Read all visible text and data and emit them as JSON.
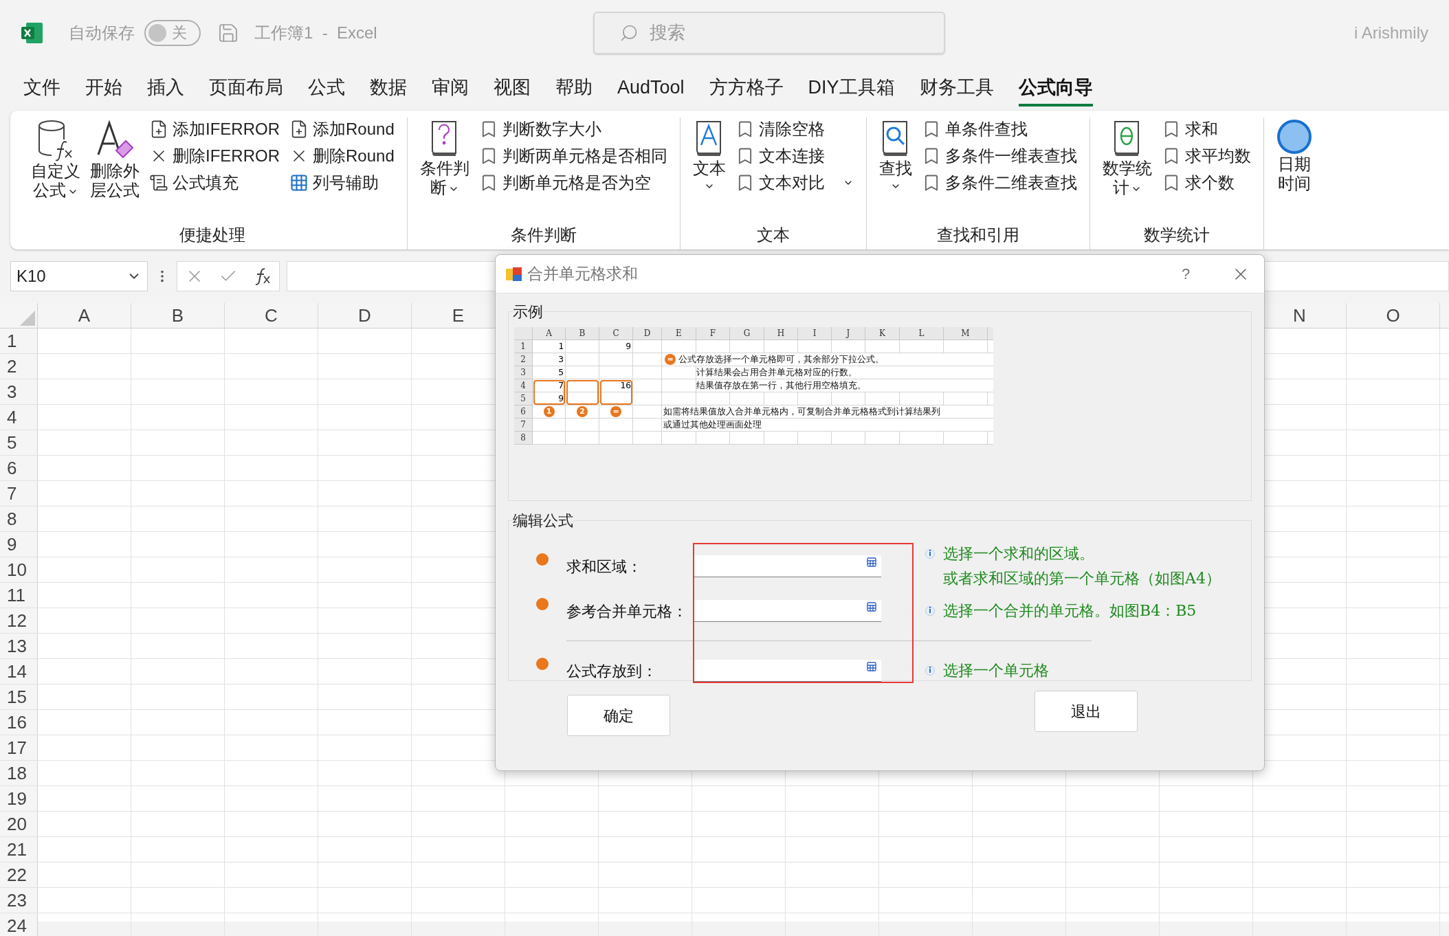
{
  "title_bar": {
    "autosave_label": "自动保存",
    "autosave": {
      "label": "关",
      "on": false
    },
    "document": "工作簿1  -  Excel",
    "search": {
      "placeholder": "搜索"
    },
    "user": "i Arishmily"
  },
  "menu_tabs": [
    {
      "label": "文件",
      "selected": false
    },
    {
      "label": "开始",
      "selected": false
    },
    {
      "label": "插入",
      "selected": false
    },
    {
      "label": "页面布局",
      "selected": false
    },
    {
      "label": "公式",
      "selected": false
    },
    {
      "label": "数据",
      "selected": false
    },
    {
      "label": "审阅",
      "selected": false
    },
    {
      "label": "视图",
      "selected": false
    },
    {
      "label": "帮助",
      "selected": false
    },
    {
      "label": "AudTool",
      "selected": false
    },
    {
      "label": "方方格子",
      "selected": false
    },
    {
      "label": "DIY工具箱",
      "selected": false
    },
    {
      "label": "财务工具",
      "selected": false
    },
    {
      "label": "公式向导",
      "selected": true
    }
  ],
  "ribbon": {
    "groups": [
      {
        "label": "便捷处理",
        "buttons": [
          {
            "kind": "large",
            "lines": [
              "自定义",
              "公式"
            ],
            "dropdown": true
          },
          {
            "kind": "large",
            "lines": [
              "删除外",
              "层公式"
            ],
            "dropdown": false
          },
          {
            "kind": "small",
            "label": "添加IFERROR",
            "dropdown": false
          },
          {
            "kind": "small",
            "label": "删除IFERROR",
            "dropdown": false
          },
          {
            "kind": "small",
            "label": "公式填充",
            "dropdown": false
          },
          {
            "kind": "small",
            "label": "添加Round",
            "dropdown": false
          },
          {
            "kind": "small",
            "label": "删除Round",
            "dropdown": false
          },
          {
            "kind": "small",
            "label": "列号辅助",
            "dropdown": false
          }
        ]
      },
      {
        "label": "条件判断",
        "buttons": [
          {
            "kind": "large",
            "lines": [
              "条件判",
              "断"
            ],
            "dropdown": true
          },
          {
            "kind": "small",
            "label": "判断数字大小",
            "dropdown": false
          },
          {
            "kind": "small",
            "label": "判断两单元格是否相同",
            "dropdown": false
          },
          {
            "kind": "small",
            "label": "判断单元格是否为空",
            "dropdown": false
          }
        ]
      },
      {
        "label": "文本",
        "buttons": [
          {
            "kind": "large",
            "lines": [
              "文本"
            ],
            "dropdown": true
          },
          {
            "kind": "small",
            "label": "清除空格",
            "dropdown": false
          },
          {
            "kind": "small",
            "label": "文本连接",
            "dropdown": false
          },
          {
            "kind": "small",
            "label": "文本对比",
            "dropdown": true
          }
        ]
      },
      {
        "label": "查找和引用",
        "buttons": [
          {
            "kind": "large",
            "lines": [
              "查找"
            ],
            "dropdown": true
          },
          {
            "kind": "small",
            "label": "单条件查找",
            "dropdown": false
          },
          {
            "kind": "small",
            "label": "多条件一维表查找",
            "dropdown": false
          },
          {
            "kind": "small",
            "label": "多条件二维表查找",
            "dropdown": false
          }
        ]
      },
      {
        "label": "数学统计",
        "buttons": [
          {
            "kind": "large",
            "lines": [
              "数学统",
              "计"
            ],
            "dropdown": true
          },
          {
            "kind": "small",
            "label": "求和",
            "dropdown": false
          },
          {
            "kind": "small",
            "label": "求平均数",
            "dropdown": false
          },
          {
            "kind": "small",
            "label": "求个数",
            "dropdown": false
          }
        ]
      },
      {
        "buttons": [
          {
            "kind": "large",
            "lines": [
              "日期",
              "时间"
            ],
            "dropdown": false
          }
        ]
      }
    ]
  },
  "formula_bar": {
    "name_box": "K10"
  },
  "sheet": {
    "columns": [
      "A",
      "B",
      "C",
      "D",
      "E",
      "N",
      "O"
    ],
    "rows": [
      "1",
      "2",
      "3",
      "4",
      "5",
      "6",
      "7",
      "8",
      "9",
      "10",
      "11",
      "12",
      "13",
      "14",
      "15",
      "16",
      "17",
      "18",
      "19",
      "20",
      "21",
      "22",
      "23",
      "24"
    ]
  },
  "dialog": {
    "title": "合并单元格求和",
    "help": "?",
    "example": {
      "legend": "示例",
      "columns": [
        "A",
        "B",
        "C",
        "D",
        "E",
        "F",
        "G",
        "H",
        "I",
        "J",
        "K",
        "L",
        "M"
      ],
      "rows": [
        {
          "label": "1",
          "a": "1",
          "c": "9"
        },
        {
          "label": "2",
          "a": "3",
          "note": "公式存放选择一个单元格即可，其余部分下拉公式。",
          "kind": "badge",
          "note_badge": "="
        },
        {
          "label": "3",
          "a": "5",
          "note": "计算结果会占用合并单元格对应的行数。",
          "kind": "indent"
        },
        {
          "label": "4",
          "a": "7",
          "c": "16",
          "note": "结果值存放在第一行，其他行用空格填充。",
          "kind": "indent"
        },
        {
          "label": "5",
          "a": "9"
        },
        {
          "label": "6",
          "badges": [
            "1",
            "2",
            "="
          ],
          "note": "如需将结果值放入合并单元格内，可复制合并单元格格式到计算结果列",
          "kind": "plain"
        },
        {
          "label": "7",
          "note": "或通过其他处理画面处理",
          "kind": "plain"
        },
        {
          "label": "8"
        }
      ]
    },
    "form": {
      "legend": "编辑公式",
      "fields": [
        {
          "label": "求和区域：",
          "hints": [
            "选择一个求和的区域。",
            "或者求和区域的第一个单元格（如图A4）"
          ]
        },
        {
          "label": "参考合并单元格：",
          "hints": [
            "选择一个合并的单元格。如图B4：B5"
          ]
        },
        {
          "label": "公式存放到：",
          "hints": [
            "选择一个单元格"
          ]
        }
      ]
    },
    "buttons": [
      {
        "label": "确定"
      },
      {
        "label": "退出"
      }
    ]
  }
}
